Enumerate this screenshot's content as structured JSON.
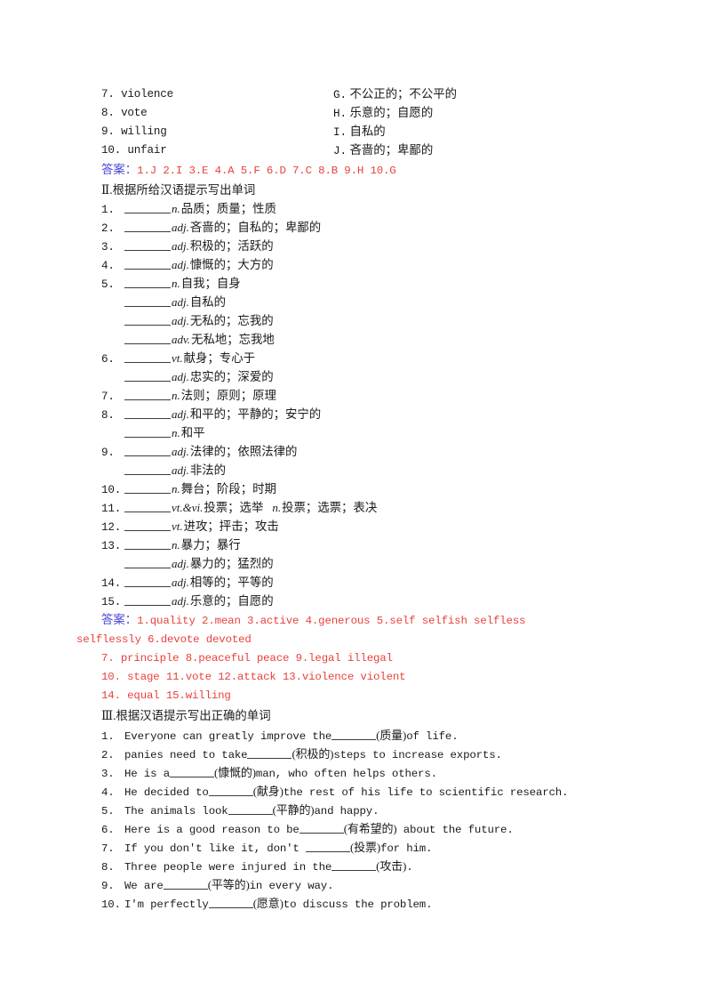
{
  "colors": {
    "text": "#1a1a1a",
    "answer_red": "#e8413c",
    "answer_label_blue": "#4a46d6",
    "page_background": "#ffffff"
  },
  "section_match": {
    "rows": [
      {
        "num": "7.",
        "word": "violence",
        "letter": "G.",
        "meaning": "不公正的；不公平的"
      },
      {
        "num": "8.",
        "word": "vote",
        "letter": "H.",
        "meaning": "乐意的；自愿的"
      },
      {
        "num": "9.",
        "word": "willing",
        "letter": "I.",
        "meaning": "自私的"
      },
      {
        "num": "10.",
        "word": "unfair",
        "letter": "J.",
        "meaning": "吝啬的；卑鄙的"
      }
    ],
    "answer_label": "答案：",
    "answer_text": "1.J  2.I  3.E  4.A  5.F  6.D  7.C  8.B  9.H  10.G"
  },
  "section_two": {
    "heading_numeral": "Ⅱ.",
    "heading_text": "根据所给汉语提示写出单词",
    "rows": [
      {
        "num": "1.",
        "pos": "n.",
        "gloss": "品质；质量；性质"
      },
      {
        "num": "2.",
        "pos": "adj.",
        "gloss": "吝啬的；自私的；卑鄙的"
      },
      {
        "num": "3.",
        "pos": "adj.",
        "gloss": "积极的；活跃的"
      },
      {
        "num": "4.",
        "pos": "adj.",
        "gloss": "慷慨的；大方的"
      },
      {
        "num": "5.",
        "pos": "n.",
        "gloss": "自我；自身"
      },
      {
        "num": "",
        "pos": "adj.",
        "gloss": "自私的"
      },
      {
        "num": "",
        "pos": "adj.",
        "gloss": "无私的；忘我的"
      },
      {
        "num": "",
        "pos": "adv.",
        "gloss": "无私地；忘我地"
      },
      {
        "num": "6.",
        "pos": "vt.",
        "gloss": "献身；专心于"
      },
      {
        "num": "",
        "pos": "adj.",
        "gloss": "忠实的；深爱的"
      },
      {
        "num": "7.",
        "pos": "n.",
        "gloss": "法则；原则；原理"
      },
      {
        "num": "8.",
        "pos": "adj.",
        "gloss": "和平的；平静的；安宁的"
      },
      {
        "num": "",
        "pos": "n.",
        "gloss": "和平"
      },
      {
        "num": "9.",
        "pos": "adj.",
        "gloss": "法律的；依照法律的"
      },
      {
        "num": "",
        "pos": "adj.",
        "gloss": "非法的"
      },
      {
        "num": "10.",
        "pos": "n.",
        "gloss": "舞台；阶段；时期"
      },
      {
        "num": "11.",
        "pos": "vt.&vi.",
        "gloss": "投票；选举",
        "pos2": "n.",
        "gloss2": "投票；选票；表决"
      },
      {
        "num": "12.",
        "pos": "vt.",
        "gloss": "进攻；抨击；攻击"
      },
      {
        "num": "13.",
        "pos": "n.",
        "gloss": "暴力；暴行"
      },
      {
        "num": "",
        "pos": "adj.",
        "gloss": "暴力的；猛烈的"
      },
      {
        "num": "14.",
        "pos": "adj.",
        "gloss": "相等的；平等的"
      },
      {
        "num": "15.",
        "pos": "adj.",
        "gloss": "乐意的；自愿的"
      }
    ],
    "answer_label": "答案：",
    "answer_lines": [
      "1.quality  2.mean  3.active  4.generous  5.self  selfish  selfless",
      "selflessly  6.devote  devoted",
      "7. principle  8.peaceful  peace  9.legal  illegal",
      "10. stage  11.vote  12.attack  13.violence  violent",
      "14. equal  15.willing"
    ]
  },
  "section_three": {
    "heading_numeral": "Ⅲ.",
    "heading_text": "根据汉语提示写出正确的单词",
    "rows": [
      {
        "num": "1.",
        "before": "Everyone can greatly improve the",
        "hint": "(质量)",
        "after": "of life."
      },
      {
        "num": "2.",
        "before": "panies need to take",
        "hint": "(积极的)",
        "after": "steps to increase exports."
      },
      {
        "num": "3.",
        "before": "He is a",
        "hint": "(慷慨的)",
        "after": "man, who often helps others."
      },
      {
        "num": "4.",
        "before": "He decided to",
        "hint": "(献身)",
        "after": "the rest of his life to scientific research."
      },
      {
        "num": "5.",
        "before": "The animals look",
        "hint": "(平静的)",
        "after": "and happy."
      },
      {
        "num": "6.",
        "before": "Here is a good reason to be",
        "hint": "(有希望的)",
        "after": " about the future."
      },
      {
        "num": "7.",
        "before": "If you don't like it, don't ",
        "hint": "(投票)",
        "after": "for him."
      },
      {
        "num": "8.",
        "before": "Three people were injured in the",
        "hint": "(攻击)",
        "after": "."
      },
      {
        "num": "9.",
        "before": "We are",
        "hint": "(平等的)",
        "after": "in every way."
      },
      {
        "num": "10.",
        "before": "I'm perfectly",
        "hint": "(愿意)",
        "after": "to discuss the problem."
      }
    ]
  }
}
